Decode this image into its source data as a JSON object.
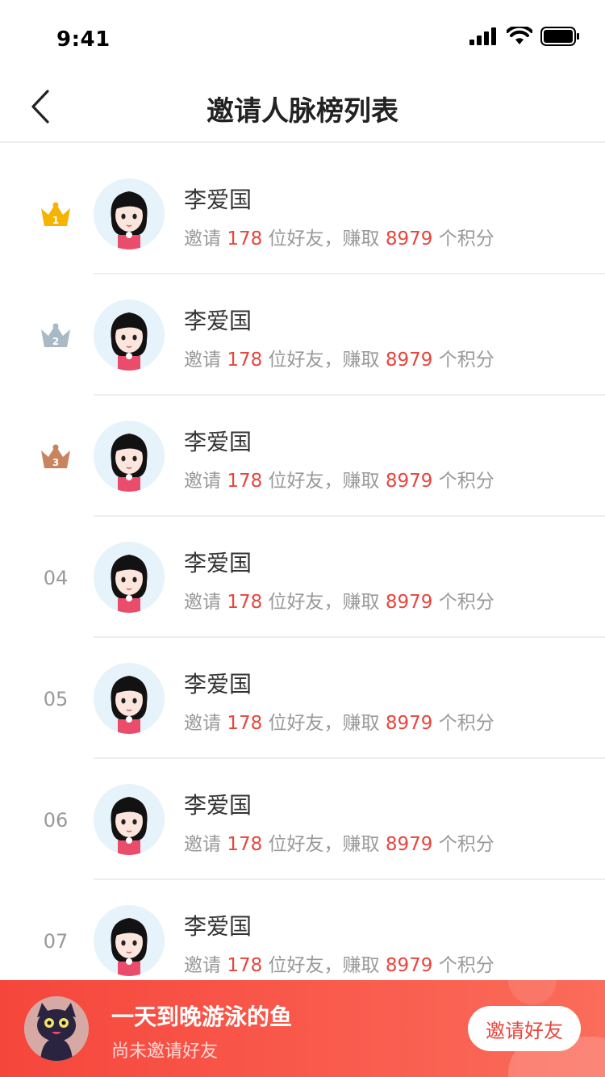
{
  "status_bar": {
    "time": "9:41"
  },
  "nav": {
    "title": "邀请人脉榜列表"
  },
  "list": {
    "items": [
      {
        "rank": "1",
        "rank_kind": "gold-crown",
        "name": "李爱国",
        "invite_prefix": "邀请",
        "friends": "178",
        "friends_suffix": "位好友，赚取",
        "points": "8979",
        "points_suffix": "个积分"
      },
      {
        "rank": "2",
        "rank_kind": "silver-crown",
        "name": "李爱国",
        "invite_prefix": "邀请",
        "friends": "178",
        "friends_suffix": "位好友，赚取",
        "points": "8979",
        "points_suffix": "个积分"
      },
      {
        "rank": "3",
        "rank_kind": "bronze-crown",
        "name": "李爱国",
        "invite_prefix": "邀请",
        "friends": "178",
        "friends_suffix": "位好友，赚取",
        "points": "8979",
        "points_suffix": "个积分"
      },
      {
        "rank": "04",
        "rank_kind": "number",
        "name": "李爱国",
        "invite_prefix": "邀请",
        "friends": "178",
        "friends_suffix": "位好友，赚取",
        "points": "8979",
        "points_suffix": "个积分"
      },
      {
        "rank": "05",
        "rank_kind": "number",
        "name": "李爱国",
        "invite_prefix": "邀请",
        "friends": "178",
        "friends_suffix": "位好友，赚取",
        "points": "8979",
        "points_suffix": "个积分"
      },
      {
        "rank": "06",
        "rank_kind": "number",
        "name": "李爱国",
        "invite_prefix": "邀请",
        "friends": "178",
        "friends_suffix": "位好友，赚取",
        "points": "8979",
        "points_suffix": "个积分"
      },
      {
        "rank": "07",
        "rank_kind": "number",
        "name": "李爱国",
        "invite_prefix": "邀请",
        "friends": "178",
        "friends_suffix": "位好友，赚取",
        "points": "8979",
        "points_suffix": "个积分"
      }
    ]
  },
  "me": {
    "name": "一天到晚游泳的鱼",
    "status": "尚未邀请好友",
    "invite_label": "邀请好友"
  },
  "colors": {
    "accent": "#e8453c",
    "gold": "#f5b400",
    "silver": "#a9b9c6",
    "bronze": "#c8845e",
    "bar_start": "#f6463c",
    "bar_end": "#fb6c5a"
  }
}
